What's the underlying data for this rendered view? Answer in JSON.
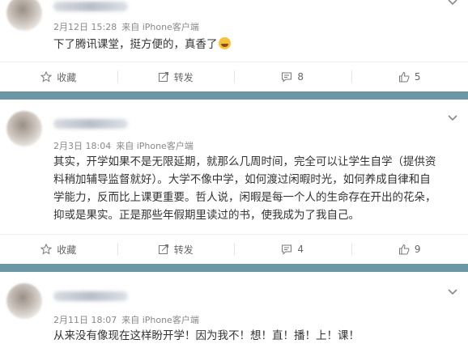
{
  "posts": [
    {
      "time": "2月12日 15:28",
      "source": "来自 iPhone客户端",
      "text": "下了腾讯课堂，挺方便的，真香了",
      "emoji": "grinning-sweat-emoji",
      "actions": {
        "collect": "收藏",
        "repost": "转发",
        "comment_count": "8",
        "like_count": "5"
      }
    },
    {
      "time": "2月3日 18:04",
      "source": "来自 iPhone客户端",
      "lines": [
        "其实，开学如果不是无限延期，就那么几周时间，完全可以让学生自学（提供资",
        "料稍加辅导监督就好）。大学不像中学，如何渡过闲暇时光，如何养成自律和自",
        "学能力，反而比上课更重要。哲人说，闲暇是每一个人的生命存在开出的花朵，",
        "抑或是果实。正是那些年假期里读过的书，使我成为了我自己。"
      ],
      "actions": {
        "collect": "收藏",
        "repost": "转发",
        "comment_count": "4",
        "like_count": "9"
      }
    },
    {
      "time": "2月11日 18:07",
      "source": "来自 iPhone客户端",
      "text": "从来没有像现在这样盼开学！因为我不！想！直！播！上！课！"
    }
  ],
  "colors": {
    "separator": "#6a96a6",
    "meta": "#888888",
    "text": "#333333"
  }
}
